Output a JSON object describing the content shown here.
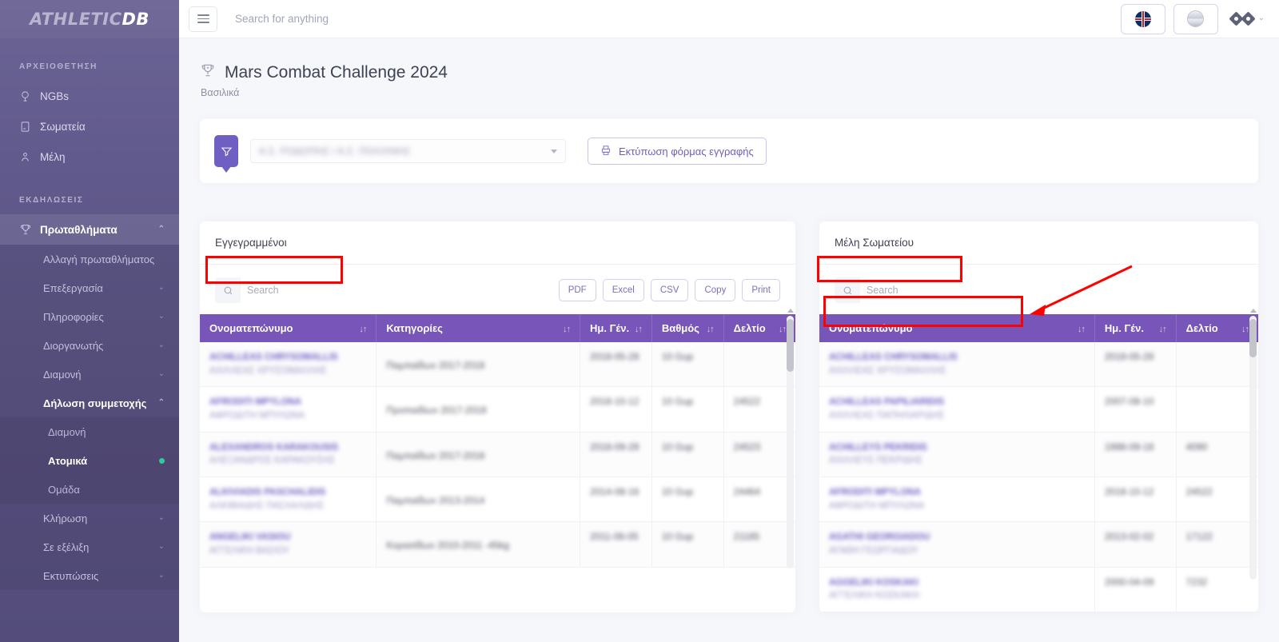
{
  "brand": {
    "part1": "ATHLETIC",
    "part2": "DB"
  },
  "topbar": {
    "search_placeholder": "Search for anything",
    "menu_icon": "hamburger-icon",
    "language_icon": "uk-flag-icon",
    "globe_icon": "globe-icon",
    "profile_icon": "profile-chevron-icon"
  },
  "sidebar": {
    "sections": [
      {
        "label": "ΑΡΧΕΙΟΘΕΤΗΣΗ"
      },
      {
        "label": "ΕΚΔΗΛΩΣΕΙΣ"
      }
    ],
    "archive_items": [
      {
        "label": "NGBs",
        "icon": "globe-outline-icon"
      },
      {
        "label": "Σωματεία",
        "icon": "club-card-icon"
      },
      {
        "label": "Μέλη",
        "icon": "member-icon"
      }
    ],
    "events_group": {
      "label": "Πρωταθλήματα",
      "icon": "trophy-icon",
      "chevron": "⌃"
    },
    "events_items": [
      {
        "label": "Αλλαγή πρωταθλήματος",
        "chevron": ""
      },
      {
        "label": "Επεξεργασία",
        "chevron": "⌄"
      },
      {
        "label": "Πληροφορίες",
        "chevron": "⌄"
      },
      {
        "label": "Διοργανωτής",
        "chevron": "⌄"
      },
      {
        "label": "Διαμονή",
        "chevron": "⌄"
      },
      {
        "label": "Δήλωση συμμετοχής",
        "chevron": "⌃",
        "open": true
      }
    ],
    "participation_items": [
      {
        "label": "Διαμονή",
        "current": false
      },
      {
        "label": "Ατομικά",
        "current": true,
        "badge": "dot"
      },
      {
        "label": "Ομάδα",
        "current": false
      }
    ],
    "events_items_tail": [
      {
        "label": "Κλήρωση",
        "chevron": "⌄"
      },
      {
        "label": "Σε εξέλιξη",
        "chevron": "⌄"
      },
      {
        "label": "Εκτυπώσεις",
        "chevron": "⌄"
      }
    ]
  },
  "page": {
    "title": "Mars Combat Challenge 2024",
    "subtitle": "Βασιλικά",
    "title_icon": "trophy-icon"
  },
  "filter_bar": {
    "filter_icon": "funnel-icon",
    "club_select_value": "Α.Σ. ΡΟΔΟΠΗΣ / Α.Σ. ΠΟΛΙΧΝΗΣ",
    "print_button": {
      "label": "Εκτύπωση φόρμας εγγραφής",
      "icon": "printer-icon"
    }
  },
  "left_panel": {
    "title": "Εγγεγραμμένοι",
    "search": {
      "placeholder": "Search",
      "value": "",
      "icon": "search-icon"
    },
    "export_buttons": [
      "PDF",
      "Excel",
      "CSV",
      "Copy",
      "Print"
    ],
    "columns": [
      {
        "label": "Ονοματεπώνυμο",
        "sort": "↓↑"
      },
      {
        "label": "Κατηγορίες",
        "sort": "↓↑"
      },
      {
        "label": "Ημ. Γέν.",
        "sort": "↓↑"
      },
      {
        "label": "Βαθμός",
        "sort": "↓↑"
      },
      {
        "label": "Δελτίο",
        "sort": "↓↑"
      }
    ],
    "rows": [
      {
        "name_en": "ACHILLEAS CHRYSOMALLIS",
        "name_gr": "ΑΧΙΛΛΕΑΣ ΧΡΥΣΟΜΑΛΛΗΣ",
        "category": "Παμπαίδων 2017-2018",
        "birth": "2018-05-28",
        "grade": "10 Gup",
        "card": ""
      },
      {
        "name_en": "AFRODITI MPYLONA",
        "name_gr": "ΑΦΡΟΔΙΤΗ ΜΠΥΛΩΝΑ",
        "category": "Προπαιδίων 2017-2018",
        "birth": "2018-10-12",
        "grade": "10 Gup",
        "card": "24522"
      },
      {
        "name_en": "ALEXANDROS KARAKOUSIS",
        "name_gr": "ΑΛΕΞΑΝΔΡΟΣ ΚΑΡΑΚΟΥΣΗΣ",
        "category": "Παμπαίδων 2017-2018",
        "birth": "2018-09-28",
        "grade": "10 Gup",
        "card": "24523"
      },
      {
        "name_en": "ALKIVIADIS PASCHALIDIS",
        "name_gr": "ΑΛΚΙΒΙΑΔΗΣ ΠΑΣΧΑΛΙΔΗΣ",
        "category": "Παμπαίδων 2013-2014",
        "birth": "2014-08-16",
        "grade": "10 Gup",
        "card": "24464"
      },
      {
        "name_en": "ANGELIKI VASIOU",
        "name_gr": "ΑΓΓΕΛΙΚΗ ΒΑΣΙΟΥ",
        "category": "Κορασίδων 2010-2011 -45kg",
        "birth": "2011-06-05",
        "grade": "10 Gup",
        "card": "21185"
      }
    ],
    "scrollbar": {
      "name": "left-table-scrollbar"
    }
  },
  "right_panel": {
    "title": "Μέλη Σωματείου",
    "search": {
      "placeholder": "Search",
      "value": "",
      "icon": "search-icon"
    },
    "columns": [
      {
        "label": "Ονοματεπώνυμο",
        "sort": "↓↑"
      },
      {
        "label": "Ημ. Γέν.",
        "sort": "↓↑"
      },
      {
        "label": "Δελτίο",
        "sort": "↓↑"
      }
    ],
    "rows": [
      {
        "name_en": "ACHILLEAS CHRYSOMALLIS",
        "name_gr": "ΑΧΙΛΛΕΑΣ ΧΡΥΣΟΜΑΛΛΗΣ",
        "birth": "2018-05-28",
        "card": ""
      },
      {
        "name_en": "ACHILLEAS PAPILIARIDIS",
        "name_gr": "ΑΧΙΛΛΕΑΣ ΠΑΠΗΛΙΑΡΙΔΗΣ",
        "birth": "2007-08-10",
        "card": ""
      },
      {
        "name_en": "ACHILLEYS PEKRIDIS",
        "name_gr": "ΑΧΙΛΛΕΥΣ ΠΕΚΡΙΔΗΣ",
        "birth": "1998-09-18",
        "card": "4090"
      },
      {
        "name_en": "AFRODITI MPYLONA",
        "name_gr": "ΑΦΡΟΔΙΤΗ ΜΠΥΛΩΝΑ",
        "birth": "2018-10-12",
        "card": "24522"
      },
      {
        "name_en": "AGATHI GEORGIADOU",
        "name_gr": "ΑΓΑΘΗ ΓΕΩΡΓΙΑΔΟΥ",
        "birth": "2013-02-02",
        "card": "17122"
      },
      {
        "name_en": "AGGELIKI KOSKAKI",
        "name_gr": "ΑΓΓΕΛΙΚΗ ΚΟΣΚΑΚΗ",
        "birth": "2000-04-09",
        "card": "7232"
      }
    ],
    "scrollbar": {
      "name": "right-table-scrollbar"
    }
  },
  "annotations": {
    "color": "#ff0000",
    "boxes": [
      {
        "name": "highlight-left-panel-title"
      },
      {
        "name": "highlight-right-panel-title"
      },
      {
        "name": "highlight-right-search-box"
      }
    ],
    "arrow": {
      "name": "pointer-arrow-to-search"
    }
  }
}
